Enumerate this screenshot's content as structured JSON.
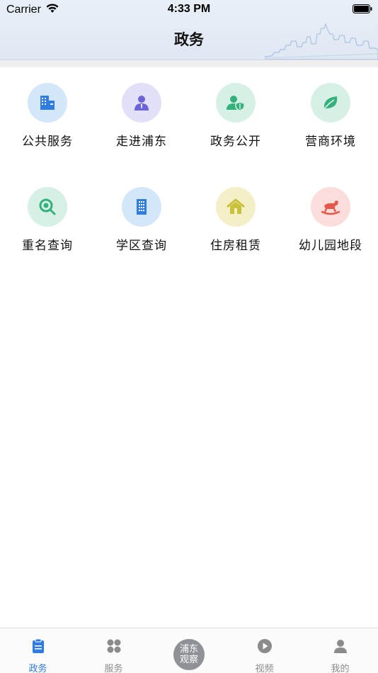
{
  "status_bar": {
    "carrier": "Carrier",
    "time": "4:33 PM"
  },
  "header": {
    "title": "政务"
  },
  "grid": {
    "items": [
      {
        "label": "公共服务",
        "icon": "building-icon",
        "bg": "#d3e6fa",
        "fg": "#2f7de1"
      },
      {
        "label": "走进浦东",
        "icon": "person-icon",
        "bg": "#e2e0f8",
        "fg": "#6c63d9"
      },
      {
        "label": "政务公开",
        "icon": "user-shield-icon",
        "bg": "#d6f0e6",
        "fg": "#33b07c"
      },
      {
        "label": "营商环境",
        "icon": "leaf-icon",
        "bg": "#d6f0e6",
        "fg": "#33b07c"
      },
      {
        "label": "重名查询",
        "icon": "search-icon",
        "bg": "#d6f0e6",
        "fg": "#33b07c"
      },
      {
        "label": "学区查询",
        "icon": "school-building-icon",
        "bg": "#d3e6fa",
        "fg": "#2f7de1"
      },
      {
        "label": "住房租赁",
        "icon": "house-icon",
        "bg": "#f3f0c9",
        "fg": "#c9c13a"
      },
      {
        "label": "幼儿园地段",
        "icon": "rocking-horse-icon",
        "bg": "#fbdedb",
        "fg": "#e5574a"
      }
    ]
  },
  "tabbar": {
    "tabs": [
      {
        "label": "政务",
        "icon": "document-icon",
        "active": true
      },
      {
        "label": "服务",
        "icon": "four-dots-icon",
        "active": false
      },
      {
        "label": "",
        "icon": "pudong-logo-icon",
        "active": false
      },
      {
        "label": "视频",
        "icon": "play-icon",
        "active": false
      },
      {
        "label": "我的",
        "icon": "user-icon",
        "active": false
      }
    ],
    "logo_text": "浦东观察"
  },
  "colors": {
    "accent": "#2f7de1",
    "inactive": "#8b8b8b"
  }
}
